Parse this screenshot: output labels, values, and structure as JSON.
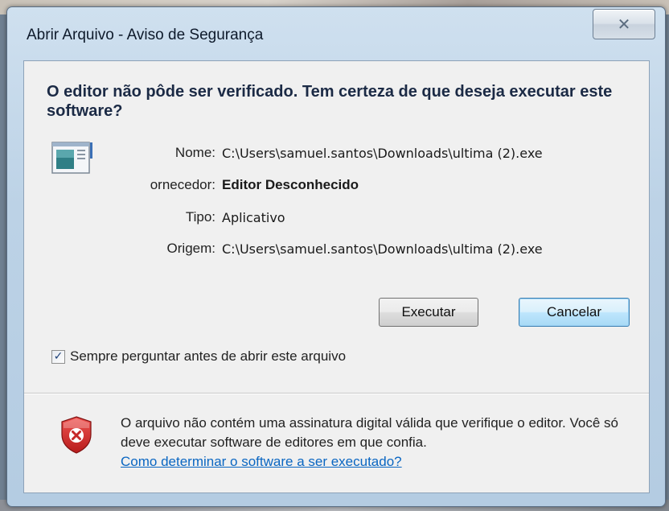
{
  "window": {
    "title": "Abrir Arquivo - Aviso de Segurança",
    "close_glyph": "✕"
  },
  "dialog": {
    "heading": "O editor não pôde ser verificado. Tem certeza de que deseja executar este software?",
    "icon": "application-window-icon",
    "fields": [
      {
        "label": "Nome:",
        "value": "C:\\Users\\samuel.santos\\Downloads\\ultima (2).exe"
      },
      {
        "label": "ornecedor:",
        "value": "Editor Desconhecido"
      },
      {
        "label": "Tipo:",
        "value": "Aplicativo"
      },
      {
        "label": "Origem:",
        "value": "C:\\Users\\samuel.santos\\Downloads\\ultima (2).exe"
      }
    ],
    "buttons": {
      "run": "Executar",
      "cancel": "Cancelar"
    },
    "checkbox": {
      "label": "Sempre perguntar antes de abrir este arquivo",
      "checked": true,
      "mark": "✓"
    },
    "warning": {
      "icon": "shield-error-icon",
      "text": "O arquivo não contém uma assinatura digital válida que verifique o editor. Você só deve executar software de editores em que confia.",
      "link": "Como determinar o software a ser executado?"
    }
  },
  "colors": {
    "heading": "#1b2a45",
    "link": "#0a66c2",
    "default_button_border": "#3c7fb1",
    "shield_red": "#c62828"
  }
}
